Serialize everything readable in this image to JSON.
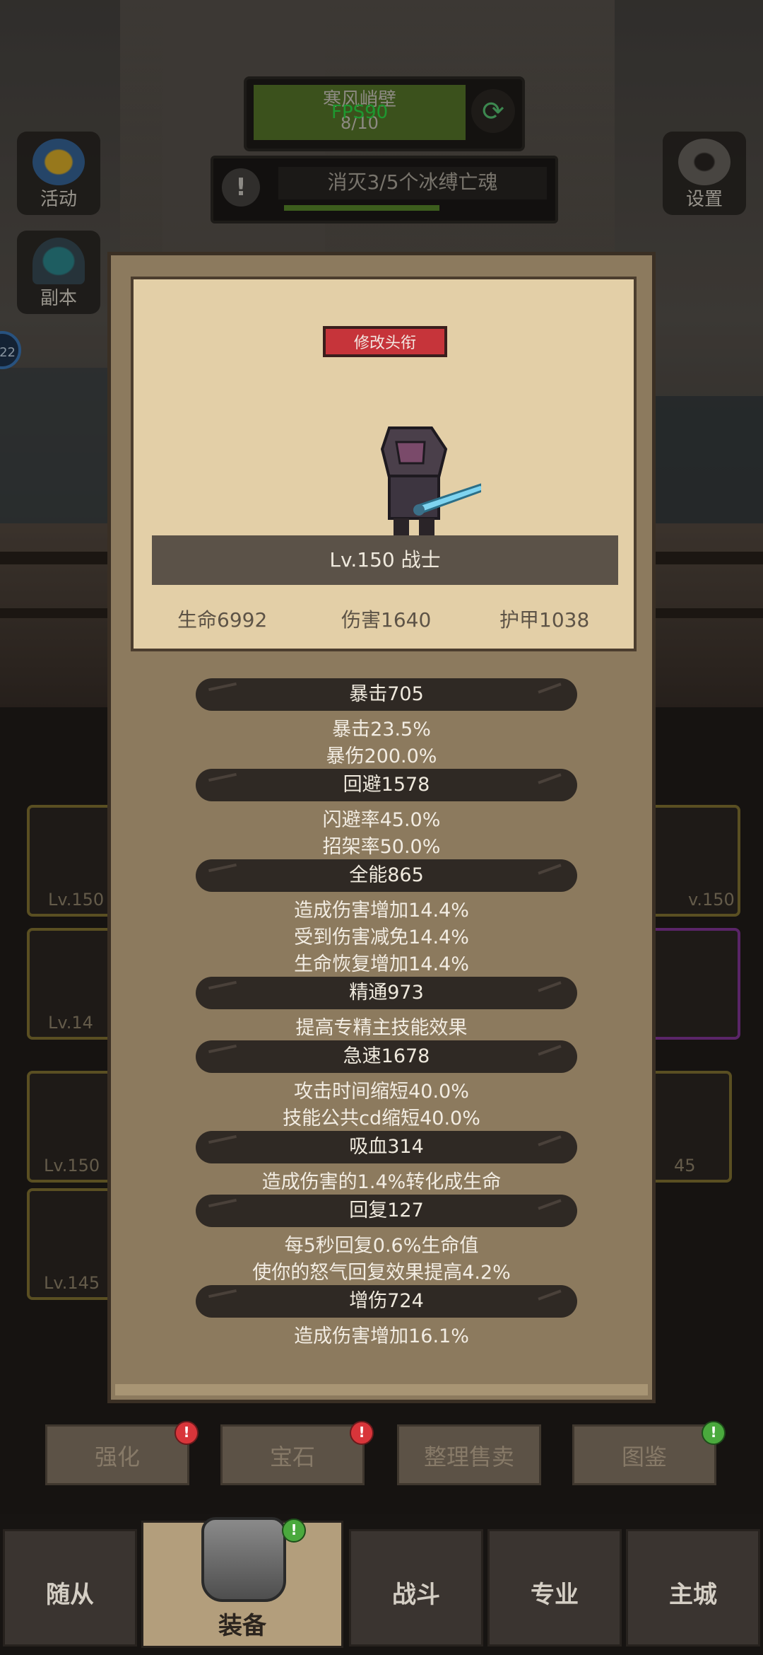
{
  "hud": {
    "stage_name": "寒风峭壁",
    "stage_progress": "8/10",
    "fps": "FPS90",
    "quest_text": "消灭3/5个冰缚亡魂",
    "side_left": [
      {
        "label": "活动",
        "icon": "star-icon"
      },
      {
        "label": "副本",
        "icon": "portal-icon"
      }
    ],
    "side_right": {
      "label": "设置",
      "icon": "gear-icon"
    },
    "round_badge": "22"
  },
  "background_slots": {
    "left": [
      "Lv.150",
      "Lv.14",
      "Lv.150",
      "Lv.145"
    ],
    "right": [
      "v.150",
      "45"
    ]
  },
  "modal": {
    "edit_title_button": "修改头衔",
    "level_class": "Lv.150 战士",
    "base_stats": {
      "hp": "生命6992",
      "damage": "伤害1640",
      "armor": "护甲1038"
    },
    "sections": [
      {
        "head": "暴击705",
        "lines": [
          "暴击23.5%",
          "暴伤200.0%"
        ]
      },
      {
        "head": "回避1578",
        "lines": [
          "闪避率45.0%",
          "招架率50.0%"
        ]
      },
      {
        "head": "全能865",
        "lines": [
          "造成伤害增加14.4%",
          "受到伤害减免14.4%",
          "生命恢复增加14.4%"
        ]
      },
      {
        "head": "精通973",
        "lines": [
          "提高专精主技能效果"
        ]
      },
      {
        "head": "急速1678",
        "lines": [
          "攻击时间缩短40.0%",
          "技能公共cd缩短40.0%"
        ]
      },
      {
        "head": "吸血314",
        "lines": [
          "造成伤害的1.4%转化成生命"
        ]
      },
      {
        "head": "回复127",
        "lines": [
          "每5秒回复0.6%生命值",
          "使你的怒气回复效果提高4.2%"
        ]
      },
      {
        "head": "增伤724",
        "lines": [
          "造成伤害增加16.1%"
        ]
      }
    ]
  },
  "actions": [
    {
      "label": "强化",
      "badge": "!",
      "badge_color": "#d8353a"
    },
    {
      "label": "宝石",
      "badge": "!",
      "badge_color": "#d8353a"
    },
    {
      "label": "整理售卖",
      "badge": "",
      "badge_color": ""
    },
    {
      "label": "图鉴",
      "badge": "!",
      "badge_color": "#4aa93d"
    }
  ],
  "nav": {
    "tabs": [
      "随从",
      "装备",
      "战斗",
      "专业",
      "主城"
    ],
    "active": "装备",
    "active_badge": "!"
  },
  "colors": {
    "accent_red": "#c6343a",
    "panel": "#e3cfa7",
    "quest_bar": "#5c8f2d",
    "fps_green": "#2eea4a"
  }
}
